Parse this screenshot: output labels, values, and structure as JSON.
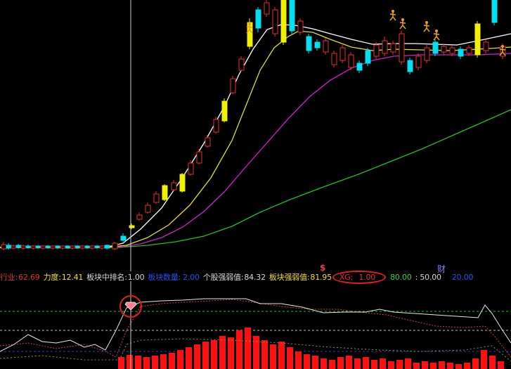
{
  "indicators": {
    "industry_label": "行业:",
    "industry_value": "62.69",
    "force_label": "力度:",
    "force_value": "12.41",
    "rank_label": "板块中排名:",
    "rank_value": "1.00",
    "board_count_label": "板块数量:",
    "board_count_value": "2.00",
    "stock_strength_label": "个股强弱值:",
    "stock_strength_value": "84.32",
    "board_strength_label": "板块强弱值:",
    "board_strength_value": "81.95",
    "xg_label": "XG:",
    "xg_value": "1.00",
    "level_80": "80.00",
    "level_50": ": 50.00",
    "level_20": "20.00"
  },
  "markers": {
    "dollar": "$",
    "cai": "财"
  },
  "colors": {
    "up": "#e8302a",
    "down": "#00e0f0",
    "limit_up": "#f0f000",
    "ma_white": "#ffffff",
    "ma_yellow": "#e0e030",
    "ma_purple": "#d020d0",
    "ma_green": "#20c020",
    "volume": "#ff1010"
  }
}
